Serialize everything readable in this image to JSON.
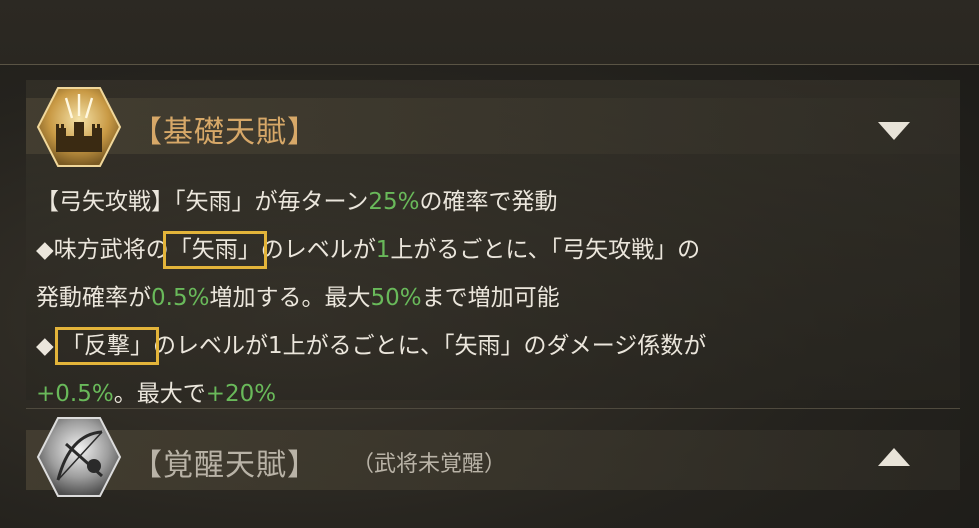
{
  "talent": {
    "title": "【基礎天賦】",
    "icon": "fortress-icon",
    "toggle": "collapse",
    "lines": [
      [
        {
          "t": "【弓矢攻戦】「矢雨」が毎ターン",
          "c": ""
        },
        {
          "t": "25%",
          "c": "g"
        },
        {
          "t": "の確率で発動",
          "c": ""
        }
      ],
      [
        {
          "t": "◆味方武将の",
          "c": ""
        },
        {
          "t": "「矢雨」",
          "c": "hl"
        },
        {
          "t": "のレベルが",
          "c": ""
        },
        {
          "t": "1",
          "c": "g"
        },
        {
          "t": "上がるごとに、「弓矢攻戦」の",
          "c": ""
        }
      ],
      [
        {
          "t": "発動確率が",
          "c": ""
        },
        {
          "t": "0.5%",
          "c": "g"
        },
        {
          "t": "増加する。最大",
          "c": ""
        },
        {
          "t": "50%",
          "c": "g"
        },
        {
          "t": "まで増加可能",
          "c": ""
        }
      ],
      [
        {
          "t": "◆ ",
          "c": ""
        },
        {
          "t": "「反撃」",
          "c": "hl"
        },
        {
          "t": "のレベルが1上がるごとに、「矢雨」のダメージ係数が",
          "c": ""
        }
      ],
      [
        {
          "t": "+0.5%",
          "c": "g"
        },
        {
          "t": "。最大で",
          "c": ""
        },
        {
          "t": "+20%",
          "c": "g"
        }
      ]
    ]
  },
  "awaken": {
    "title": "【覚醒天賦】",
    "note": "（武将未覚醒）",
    "icon": "archer-icon",
    "toggle": "expand"
  },
  "colors": {
    "accent_gold": "#d7a868",
    "value_green": "#69b95a",
    "highlight_border": "#e3b43a"
  }
}
